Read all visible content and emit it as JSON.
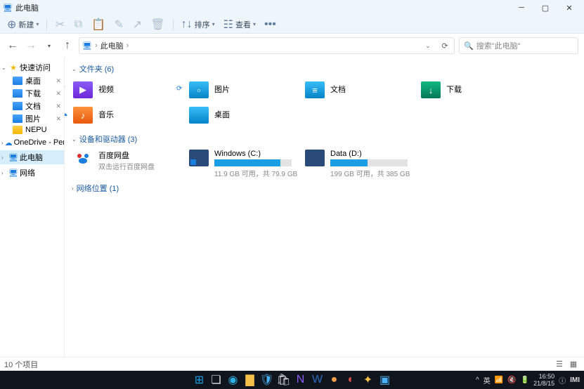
{
  "title": "此电脑",
  "toolbar": {
    "new_label": "新建",
    "sort_label": "排序",
    "view_label": "查看"
  },
  "address": {
    "location": "此电脑",
    "search_placeholder": "搜索\"此电脑\""
  },
  "sidebar": {
    "groups": [
      {
        "header": {
          "label": "快速访问",
          "expanded": true,
          "icon": "star"
        },
        "items": [
          {
            "label": "桌面",
            "icon": "blue",
            "pinned": true
          },
          {
            "label": "下载",
            "icon": "blue",
            "pinned": true
          },
          {
            "label": "文档",
            "icon": "blue",
            "pinned": true
          },
          {
            "label": "图片",
            "icon": "blue",
            "pinned": true
          },
          {
            "label": "NEPU",
            "icon": "yellow",
            "pinned": false
          }
        ]
      },
      {
        "header": {
          "label": "OneDrive - Persona",
          "expanded": false,
          "icon": "cloud"
        }
      },
      {
        "header": {
          "label": "此电脑",
          "expanded": false,
          "icon": "pc",
          "selected": true
        }
      },
      {
        "header": {
          "label": "网络",
          "expanded": false,
          "icon": "pc"
        }
      }
    ]
  },
  "content": {
    "sections": [
      {
        "title": "文件夹 (6)",
        "expanded": true,
        "items": [
          {
            "label": "视频",
            "color": "purple",
            "glyph": "▶",
            "sync": "ok"
          },
          {
            "label": "图片",
            "color": "blue",
            "glyph": "▫",
            "sync": "refresh"
          },
          {
            "label": "文档",
            "color": "blue",
            "glyph": "≡"
          },
          {
            "label": "下载",
            "color": "dl",
            "glyph": "↓"
          },
          {
            "label": "音乐",
            "color": "orange",
            "glyph": "♪",
            "sync": "cloud"
          },
          {
            "label": "桌面",
            "color": "blue",
            "glyph": ""
          }
        ]
      },
      {
        "title": "设备和驱动器 (3)",
        "expanded": true,
        "drives": [
          {
            "label": "百度网盘",
            "sub": "双击运行百度网盘",
            "kind": "baidu"
          },
          {
            "label": "Windows (C:)",
            "fill_pct": 85,
            "cap": "11.9 GB 可用，共 79.9 GB",
            "winlogo": true
          },
          {
            "label": "Data (D:)",
            "fill_pct": 48,
            "cap": "199 GB 可用，共 385 GB"
          }
        ]
      },
      {
        "title": "网络位置 (1)",
        "expanded": false
      }
    ]
  },
  "status": {
    "text": "10 个项目"
  },
  "taskbar": {
    "apps": [
      {
        "name": "start",
        "color": "#1a9ee5",
        "glyph": "⊞"
      },
      {
        "name": "task-view",
        "color": "#ddd",
        "glyph": "❏"
      },
      {
        "name": "edge",
        "color": "#2bb0e5",
        "glyph": "◉"
      },
      {
        "name": "explorer",
        "color": "#f5c04a",
        "glyph": "▇"
      },
      {
        "name": "security",
        "color": "#4ab0f5",
        "glyph": "🛡"
      },
      {
        "name": "store",
        "color": "#ddd",
        "glyph": "🛍"
      },
      {
        "name": "onenote",
        "color": "#8b5cf6",
        "glyph": "N"
      },
      {
        "name": "word",
        "color": "#2a6ac0",
        "glyph": "W"
      },
      {
        "name": "app1",
        "color": "#f5a04a",
        "glyph": "●"
      },
      {
        "name": "app2",
        "color": "#e55050",
        "glyph": "◐"
      },
      {
        "name": "app3",
        "color": "#f5c04a",
        "glyph": "✦"
      },
      {
        "name": "app4",
        "color": "#4ab0f5",
        "glyph": "▣"
      }
    ],
    "tray": {
      "ime": "英",
      "time": "16:50",
      "date": "21/8/15",
      "brand": "IMI"
    }
  }
}
